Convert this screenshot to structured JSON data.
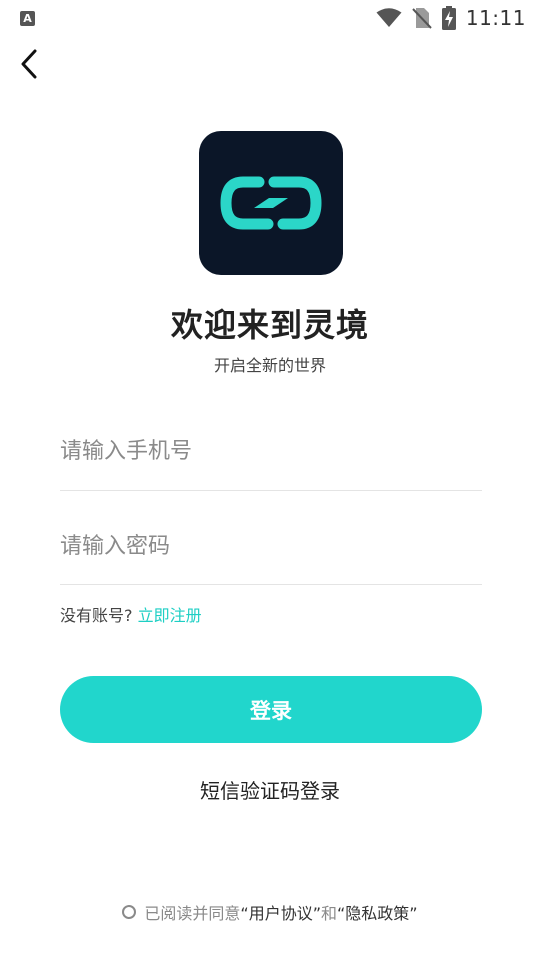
{
  "status_bar": {
    "notification_glyph": "A",
    "time": "11:11",
    "icons": [
      "wifi-icon",
      "no-sim-icon",
      "battery-charging-icon"
    ]
  },
  "back": {
    "icon": "chevron-left-icon"
  },
  "logo": {
    "icon": "link-logo-icon",
    "background": "#0b1628",
    "accent": "#2bd6c8"
  },
  "welcome": {
    "title": "欢迎来到灵境",
    "subtitle": "开启全新的世界"
  },
  "form": {
    "phone_placeholder": "请输入手机号",
    "password_placeholder": "请输入密码",
    "no_account_text": "没有账号?",
    "register_link": "立即注册",
    "login_button": "登录",
    "sms_login": "短信验证码登录"
  },
  "agreement": {
    "prefix": "已阅读并同意",
    "user_agreement": "“用户协议”",
    "and": "和",
    "privacy_policy": "“隐私政策”"
  },
  "colors": {
    "accent": "#21d6cc",
    "link": "#1ecfc4"
  }
}
